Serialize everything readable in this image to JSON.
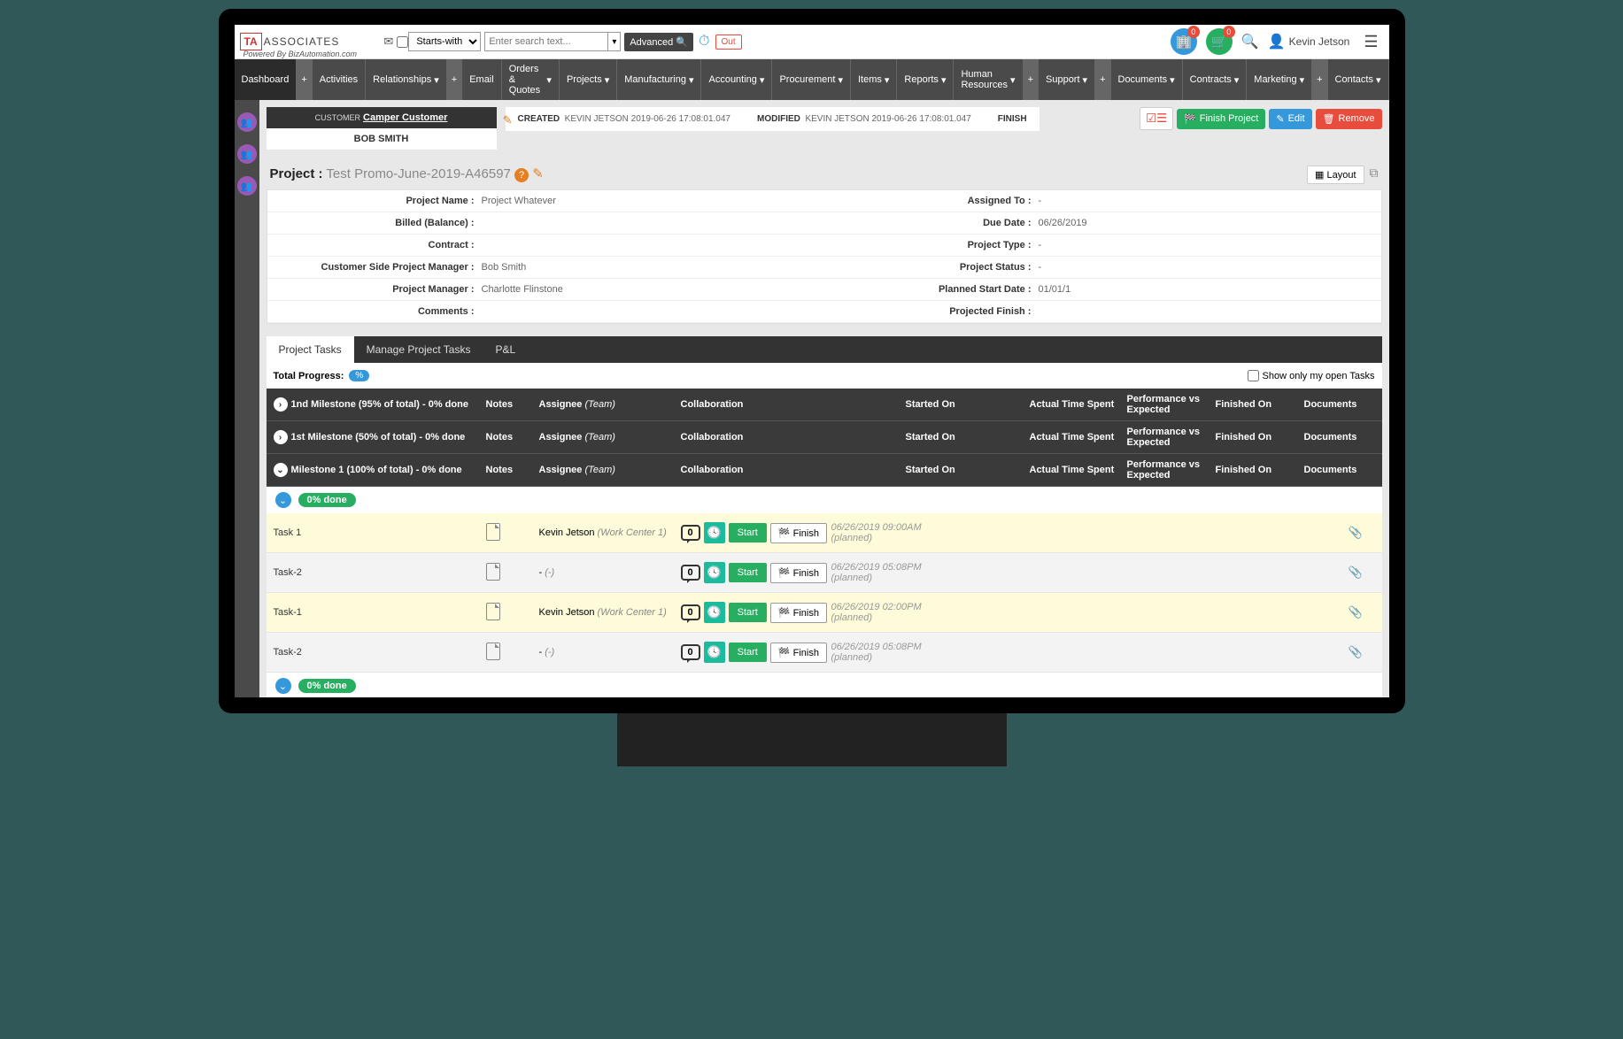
{
  "brand": {
    "mark": "TA",
    "name": "ASSOCIATES",
    "powered": "Powered By BizAutomation.com"
  },
  "search": {
    "mode": "Starts-with",
    "placeholder": "Enter search text...",
    "advanced": "Advanced",
    "out": "Out"
  },
  "toolbar": {
    "badge1": "0",
    "badge2": "0",
    "user": "Kevin Jetson"
  },
  "nav": [
    "Dashboard",
    "Activities",
    "Relationships",
    "Email",
    "Orders & Quotes",
    "Projects",
    "Manufacturing",
    "Accounting",
    "Procurement",
    "Items",
    "Reports",
    "Human Resources",
    "Support",
    "Documents",
    "Contracts",
    "Marketing",
    "Contacts"
  ],
  "customer": {
    "label": "CUSTOMER",
    "name": "Camper Customer",
    "contact": "BOB SMITH"
  },
  "meta": {
    "created_l": "CREATED",
    "created_v": "KEVIN JETSON 2019-06-26 17:08:01.047",
    "modified_l": "MODIFIED",
    "modified_v": "KEVIN JETSON 2019-06-26 17:08:01.047",
    "finish_l": "FINISH"
  },
  "actions": {
    "finish": "Finish Project",
    "edit": "Edit",
    "remove": "Remove"
  },
  "project": {
    "label": "Project :",
    "name": "Test Promo-June-2019-A46597",
    "layout": "Layout"
  },
  "details": [
    {
      "l1": "Project Name :",
      "v1": "Project Whatever",
      "l2": "Assigned To :",
      "v2": "-"
    },
    {
      "l1": "Billed (Balance) :",
      "v1": "",
      "l2": "Due Date :",
      "v2": "06/26/2019"
    },
    {
      "l1": "Contract :",
      "v1": "",
      "l2": "Project Type :",
      "v2": "-"
    },
    {
      "l1": "Customer Side Project Manager :",
      "v1": "Bob Smith",
      "l2": "Project Status :",
      "v2": "-"
    },
    {
      "l1": "Project Manager :",
      "v1": "Charlotte Flinstone",
      "l2": "Planned Start Date :",
      "v2": "01/01/1"
    },
    {
      "l1": "Comments :",
      "v1": "",
      "l2": "Projected Finish :",
      "v2": ""
    }
  ],
  "tabs": [
    "Project Tasks",
    "Manage Project Tasks",
    "P&L"
  ],
  "progress": {
    "label": "Total Progress:",
    "pct": "%",
    "openonly": "Show only my open Tasks"
  },
  "cols": {
    "notes": "Notes",
    "assign": "Assignee",
    "team": "(Team)",
    "collab": "Collaboration",
    "start": "Started On",
    "time": "Actual Time Spent",
    "perf": "Performance vs Expected",
    "fin": "Finished On",
    "doc": "Documents"
  },
  "milestones": [
    {
      "title": "1nd Milestone (95% of total) - 0% done",
      "open": false
    },
    {
      "title": "1st Milestone (50% of total) - 0% done",
      "open": false
    },
    {
      "title": "Milestone 1 (100% of total) - 0% done",
      "open": true
    }
  ],
  "donepill": "0% done",
  "tasks": [
    {
      "name": "Task 1",
      "assignee": "Kevin Jetson",
      "team": "(Work Center 1)",
      "msgs": "0",
      "start": "06/26/2019 09:00AM (planned)",
      "hl": true
    },
    {
      "name": "Task-2",
      "assignee": "-",
      "team": "(-)",
      "msgs": "0",
      "start": "06/26/2019 05:08PM (planned)",
      "hl": false
    },
    {
      "name": "Task-1",
      "assignee": "Kevin Jetson",
      "team": "(Work Center 1)",
      "msgs": "0",
      "start": "06/26/2019 02:00PM (planned)",
      "hl": true
    },
    {
      "name": "Task-2",
      "assignee": "-",
      "team": "(-)",
      "msgs": "0",
      "start": "06/26/2019 05:08PM (planned)",
      "hl": false
    }
  ],
  "taskbtns": {
    "start": "Start",
    "finish": "Finish"
  }
}
